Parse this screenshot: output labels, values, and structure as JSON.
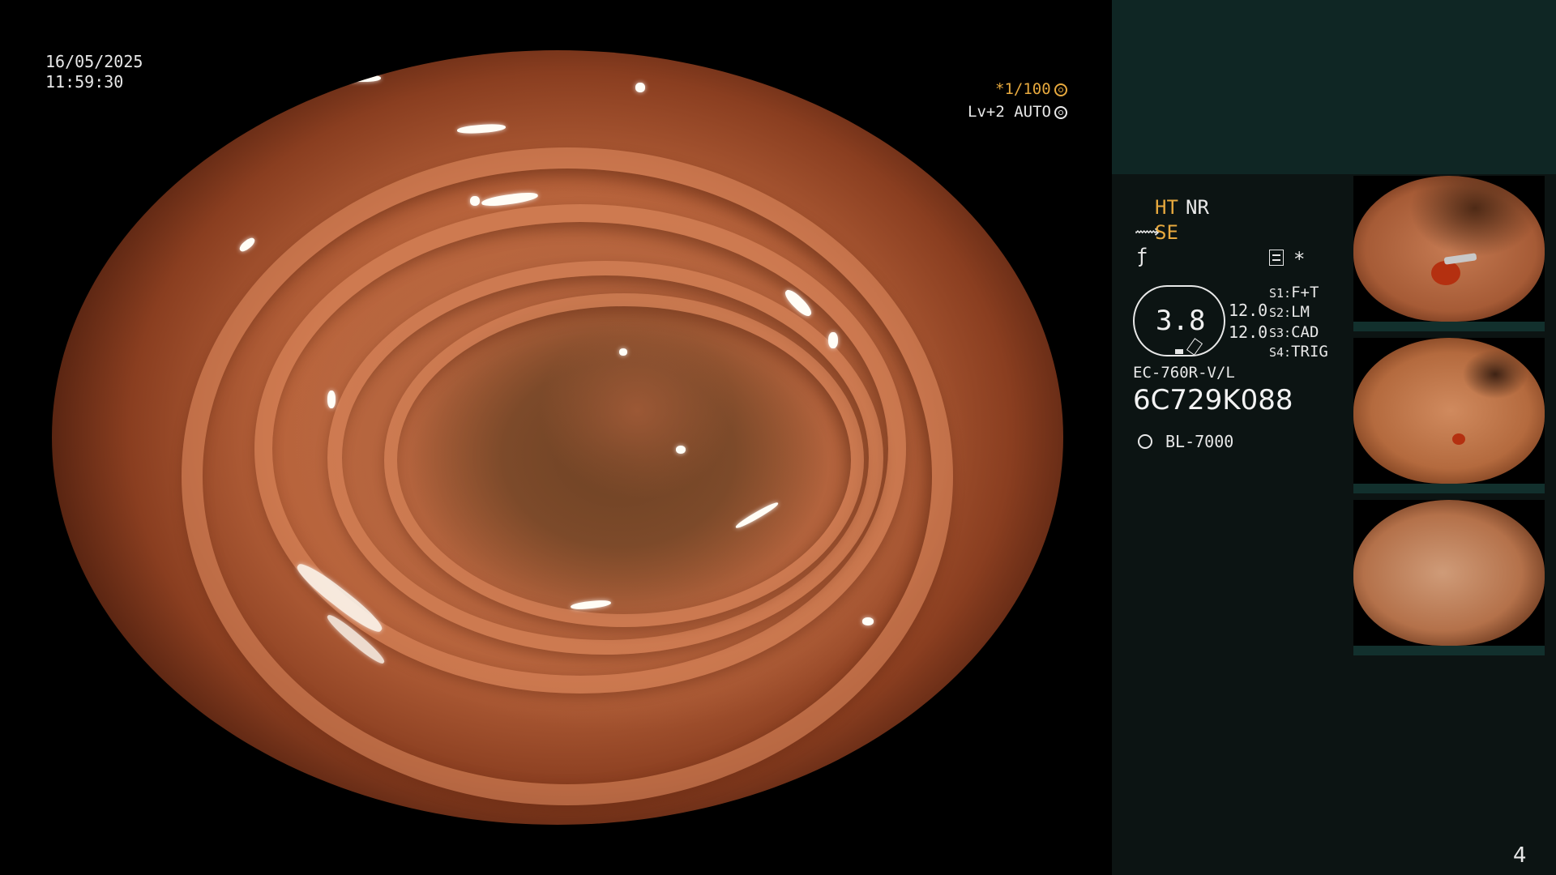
{
  "header": {
    "date": "16/05/2025",
    "time": "11:59:30",
    "zoom": "*1/100",
    "level": "Lv+2 AUTO"
  },
  "panel": {
    "ht": "HT",
    "nr": "NR",
    "se": "SE",
    "ratio": "3.8",
    "value1": "12.0",
    "value2": "12.0",
    "switches": [
      {
        "key": "S1:",
        "value": "F+T"
      },
      {
        "key": "S2:",
        "value": "LM"
      },
      {
        "key": "S3:",
        "value": "CAD"
      },
      {
        "key": "S4:",
        "value": "TRIG"
      }
    ],
    "scope_model": "EC-760R-V/L",
    "serial": "6C729K088",
    "light_source": "BL-7000",
    "star": "*",
    "colors": {
      "accent": "#e7a93e",
      "panel_bg": "#0c1413",
      "panel_top": "#0f2624"
    }
  },
  "thumbnails": [
    {
      "name": "capture-1",
      "icon": "endoscope-still"
    },
    {
      "name": "capture-2",
      "icon": "endoscope-still"
    },
    {
      "name": "capture-3",
      "icon": "endoscope-still"
    }
  ],
  "page_number": "4"
}
